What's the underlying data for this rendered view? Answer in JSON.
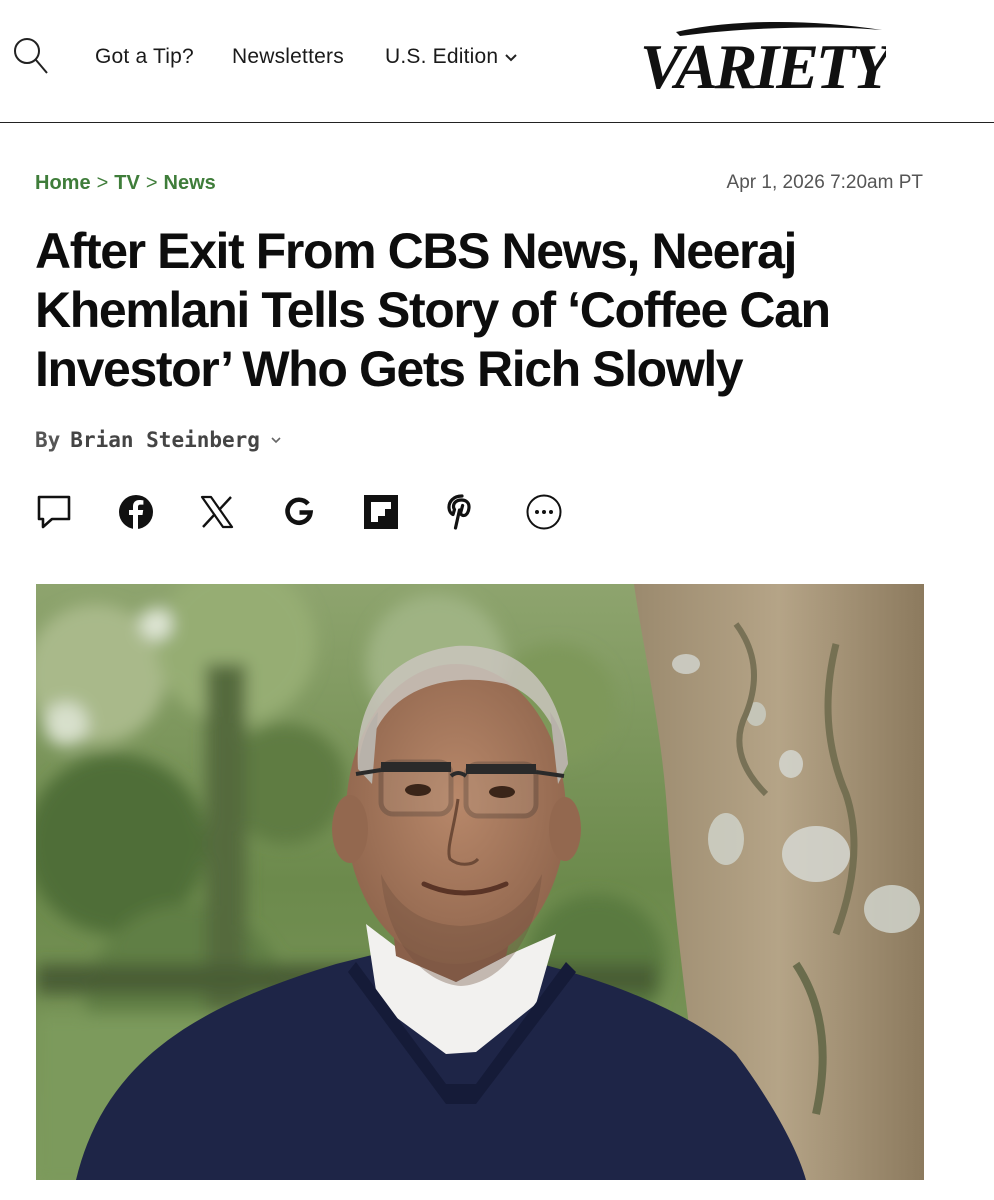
{
  "header": {
    "search_icon": "search-icon",
    "nav": {
      "tip_label": "Got a Tip?",
      "newsletters_label": "Newsletters",
      "edition_label": "U.S. Edition"
    },
    "logo_text": "VARIETY"
  },
  "article": {
    "breadcrumb": {
      "home": "Home",
      "section": "TV",
      "subsection": "News",
      "separator": ">"
    },
    "timestamp": "Apr 1, 2026 7:20am PT",
    "headline_lines": [
      "After Exit From CBS News, Neeraj",
      "Khemlani Tells Story of ‘Coffee Can",
      "Investor’ Who Gets Rich Slowly"
    ],
    "byline": {
      "by": "By",
      "author": "Brian Steinberg"
    },
    "share_icons": [
      "comment-icon",
      "facebook-icon",
      "x-icon",
      "google-icon",
      "flipboard-icon",
      "pinterest-icon",
      "more-icon"
    ]
  },
  "colors": {
    "breadcrumb": "#3f7d3a",
    "text": "#111111",
    "divider": "#222222"
  }
}
